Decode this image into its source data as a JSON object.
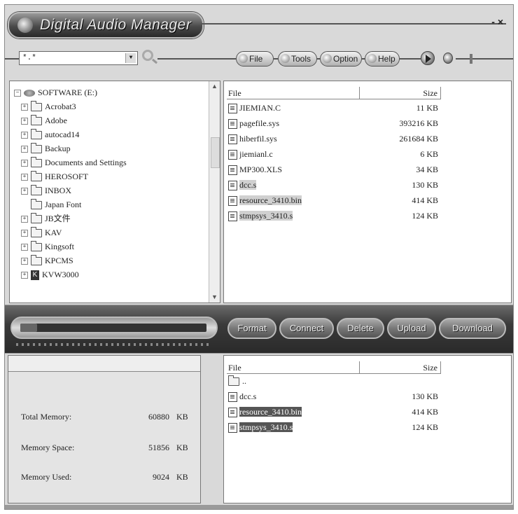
{
  "window": {
    "title": "Digital Audio Manager",
    "controls": "- ×"
  },
  "toolbar": {
    "filter_value": "*.*",
    "buttons": [
      "File",
      "Tools",
      "Option",
      "Help"
    ]
  },
  "tree": {
    "root": "SOFTWARE (E:)",
    "items": [
      {
        "label": "Acrobat3",
        "icon": "folder-icon"
      },
      {
        "label": "Adobe",
        "icon": "folder-icon"
      },
      {
        "label": "autocad14",
        "icon": "folder-icon"
      },
      {
        "label": "Backup",
        "icon": "folder-icon"
      },
      {
        "label": "Documents and Settings",
        "icon": "folder-icon"
      },
      {
        "label": "HEROSOFT",
        "icon": "folder-icon"
      },
      {
        "label": "INBOX",
        "icon": "folder-icon"
      },
      {
        "label": "Japan Font",
        "icon": "folder-icon"
      },
      {
        "label": "JB文件",
        "icon": "folder-icon"
      },
      {
        "label": "KAV",
        "icon": "folder-icon"
      },
      {
        "label": "Kingsoft",
        "icon": "folder-icon"
      },
      {
        "label": "KPCMS",
        "icon": "folder-icon"
      },
      {
        "label": "KVW3000",
        "icon": "k-app-icon"
      }
    ]
  },
  "pc_files": {
    "col_file": "File",
    "col_size": "Size",
    "rows": [
      {
        "name": "JIEMIAN.C",
        "size": "11 KB"
      },
      {
        "name": "pagefile.sys",
        "size": "393216 KB"
      },
      {
        "name": "hiberfil.sys",
        "size": "261684 KB"
      },
      {
        "name": "jiemianl.c",
        "size": "6 KB"
      },
      {
        "name": "MP300.XLS",
        "size": "34 KB"
      },
      {
        "name": "dcc.s",
        "size": "130 KB"
      },
      {
        "name": "resource_3410.bin",
        "size": "414 KB"
      },
      {
        "name": "stmpsys_3410.s",
        "size": "124 KB"
      }
    ]
  },
  "progress": {
    "fraction": 0.09
  },
  "actions": [
    "Format",
    "Connect",
    "Delete",
    "Upload",
    "Download"
  ],
  "memory": {
    "total_label": "Total Memory:",
    "total_value": "60880",
    "space_label": "Memory Space:",
    "space_value": "51856",
    "used_label": "Memory Used:",
    "used_value": "9024",
    "unit": "KB"
  },
  "device_files": {
    "col_file": "File",
    "col_size": "Size",
    "parent": "..",
    "rows": [
      {
        "name": "dcc.s",
        "size": "130 KB"
      },
      {
        "name": "resource_3410.bin",
        "size": "414 KB"
      },
      {
        "name": "stmpsys_3410.s",
        "size": "124 KB"
      }
    ]
  }
}
